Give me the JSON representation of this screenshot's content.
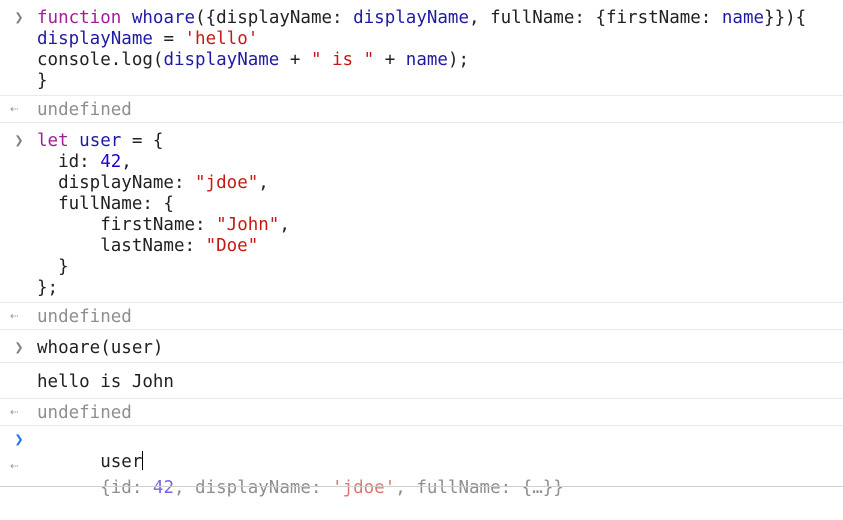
{
  "console": {
    "entries": [
      {
        "kind": "input",
        "lines": [
          [
            [
              "function",
              "kw"
            ],
            [
              " ",
              ""
            ],
            [
              "whoare",
              "fn"
            ],
            [
              "({displayName: ",
              ""
            ],
            [
              "displayName",
              "fn"
            ],
            [
              ", fullName: {firstName: ",
              ""
            ],
            [
              "name",
              "fn"
            ],
            [
              "}}){",
              ""
            ]
          ],
          [
            [
              "displayName",
              "fn"
            ],
            [
              " = ",
              ""
            ],
            [
              "'hello'",
              "str"
            ]
          ],
          [
            [
              "console.log(",
              ""
            ],
            [
              "displayName",
              "fn"
            ],
            [
              " + ",
              ""
            ],
            [
              "\" is \"",
              "str"
            ],
            [
              " + ",
              ""
            ],
            [
              "name",
              "fn"
            ],
            [
              ");",
              ""
            ]
          ],
          [
            [
              "}",
              ""
            ]
          ]
        ]
      },
      {
        "kind": "result",
        "text": "undefined"
      },
      {
        "kind": "input",
        "lines": [
          [
            [
              "let",
              "kw"
            ],
            [
              " ",
              ""
            ],
            [
              "user",
              "fn"
            ],
            [
              " = {",
              ""
            ]
          ],
          [
            [
              "  id: ",
              ""
            ],
            [
              "42",
              "num"
            ],
            [
              ",",
              ""
            ]
          ],
          [
            [
              "  displayName: ",
              ""
            ],
            [
              "\"jdoe\"",
              "str"
            ],
            [
              ",",
              ""
            ]
          ],
          [
            [
              "  fullName: {",
              ""
            ]
          ],
          [
            [
              "      firstName: ",
              ""
            ],
            [
              "\"John\"",
              "str"
            ],
            [
              ",",
              ""
            ]
          ],
          [
            [
              "      lastName: ",
              ""
            ],
            [
              "\"Doe\"",
              "str"
            ]
          ],
          [
            [
              "  }",
              ""
            ]
          ],
          [
            [
              "};",
              ""
            ]
          ]
        ]
      },
      {
        "kind": "result",
        "text": "undefined"
      },
      {
        "kind": "input",
        "lines": [
          [
            [
              "whoare(user)",
              ""
            ]
          ]
        ]
      },
      {
        "kind": "log",
        "text": "hello is John"
      },
      {
        "kind": "result",
        "text": "undefined"
      }
    ],
    "current_input": "user",
    "eager_preview": {
      "open": "{id: ",
      "id": "42",
      "mid": ", displayName: ",
      "displayName": "'jdoe'",
      "tail": ", fullName: {…}}"
    }
  }
}
